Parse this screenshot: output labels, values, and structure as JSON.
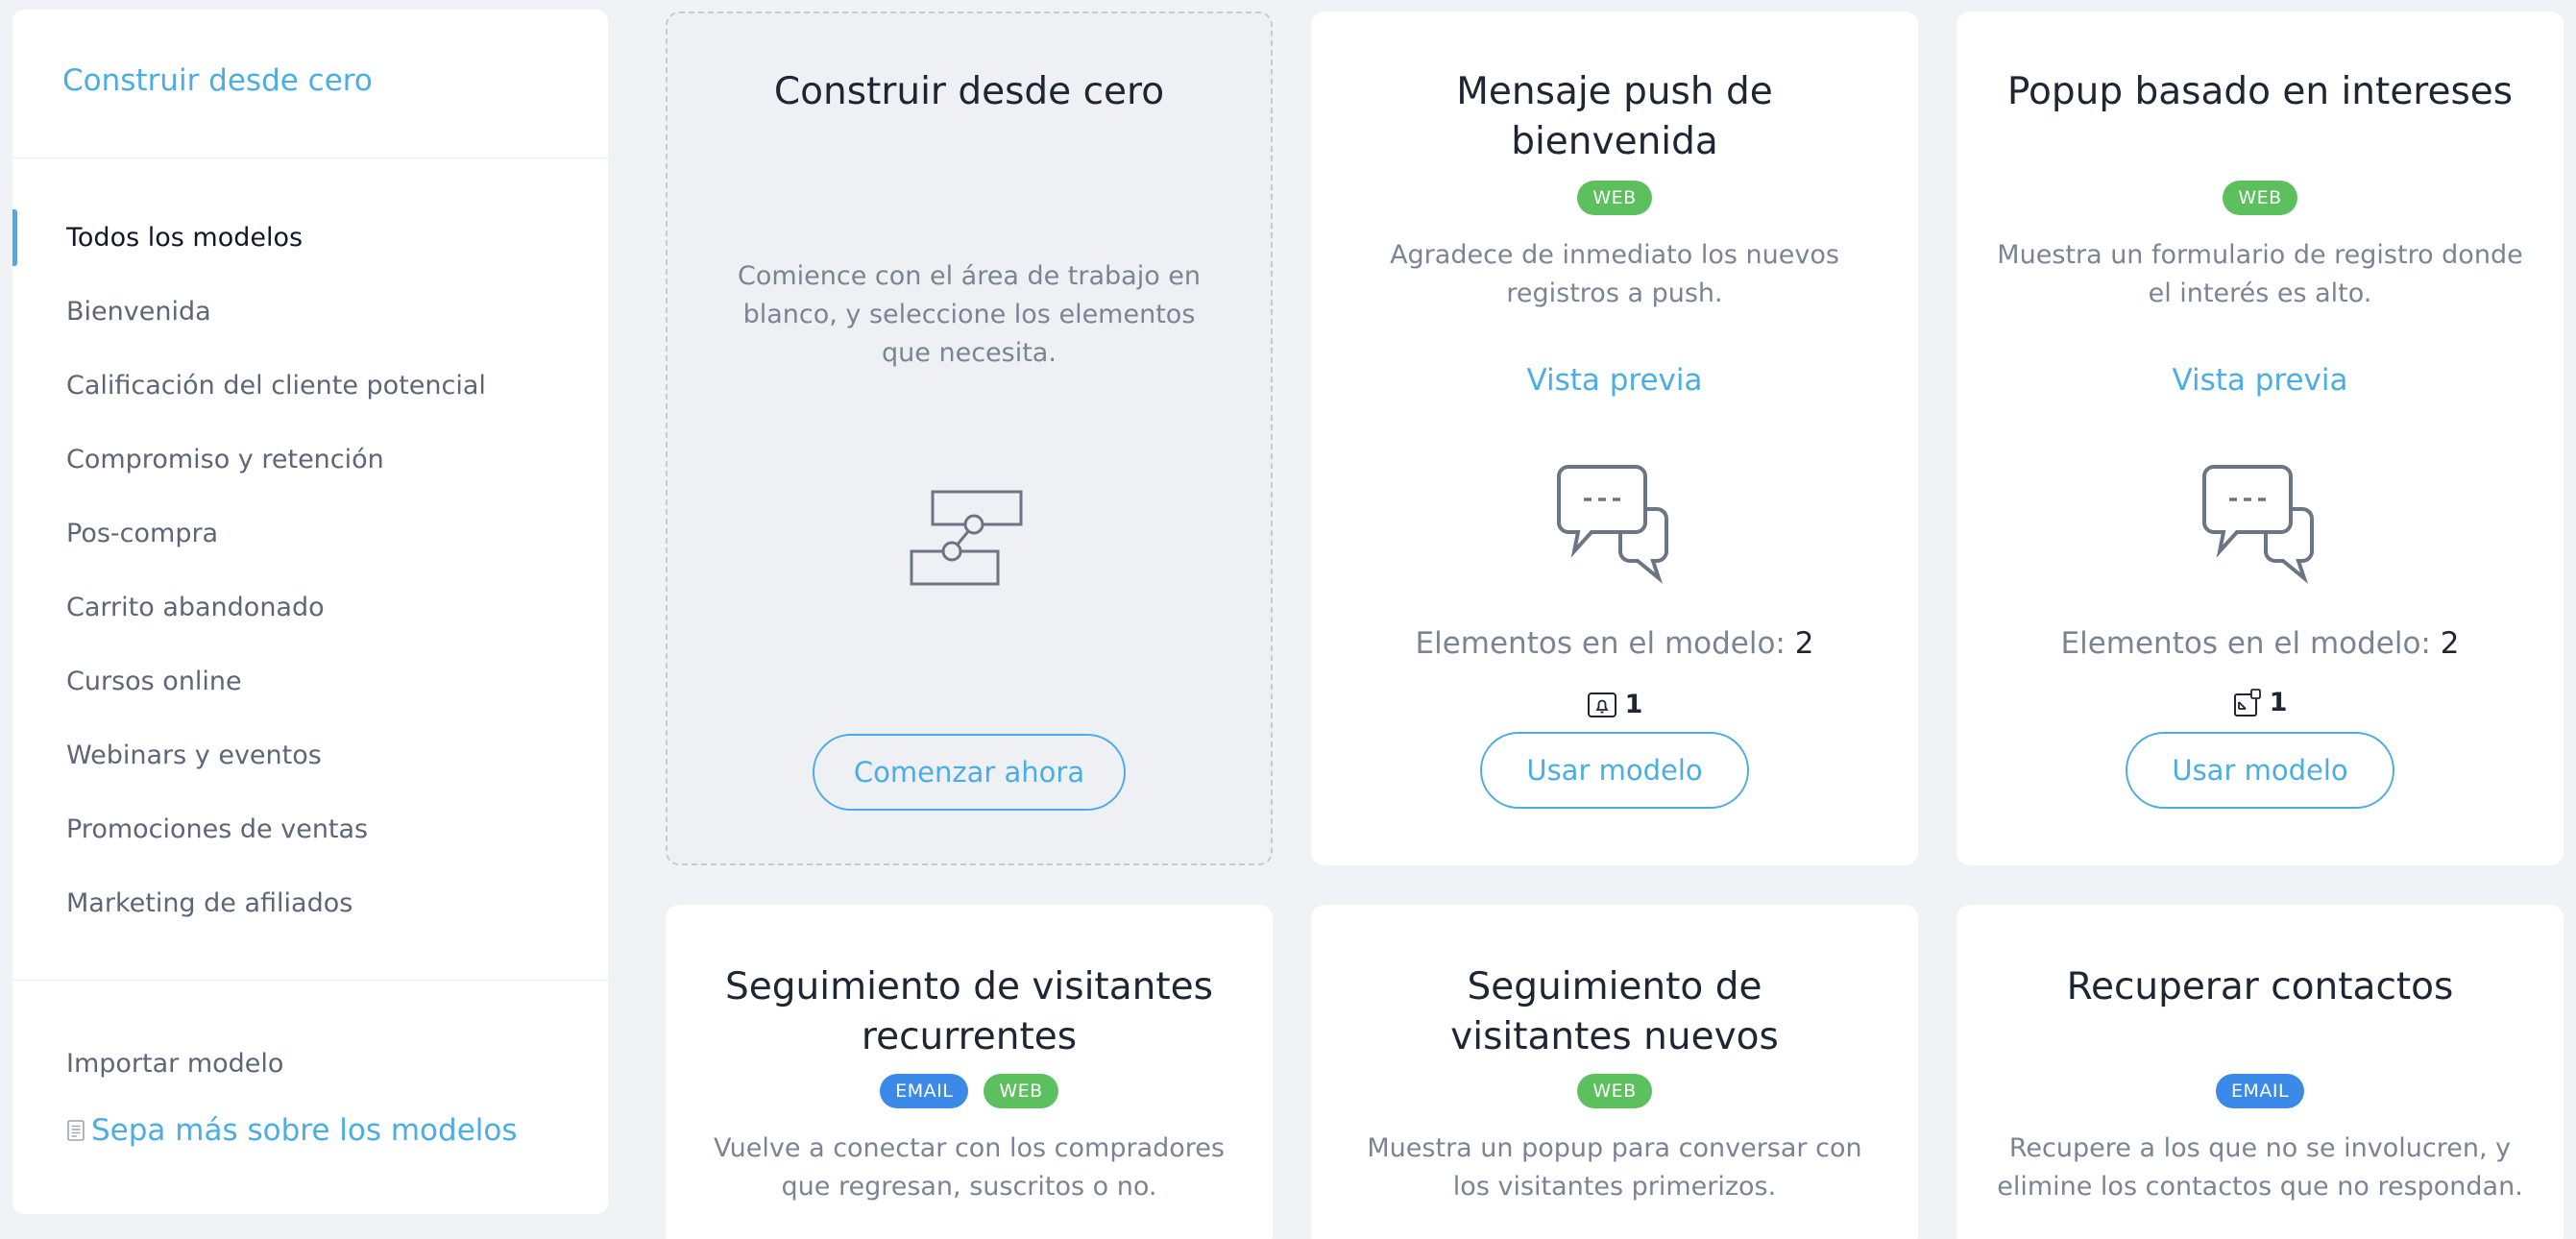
{
  "sidebar": {
    "top_link": "Construir desde cero",
    "items": [
      {
        "label": "Todos los modelos",
        "active": true
      },
      {
        "label": "Bienvenida"
      },
      {
        "label": "Calificación del cliente potencial"
      },
      {
        "label": "Compromiso y retención"
      },
      {
        "label": "Pos-compra"
      },
      {
        "label": "Carrito abandonado"
      },
      {
        "label": "Cursos online"
      },
      {
        "label": "Webinars y eventos"
      },
      {
        "label": "Promociones de ventas"
      },
      {
        "label": "Marketing de afiliados"
      }
    ],
    "import_label": "Importar modelo",
    "learn_label": "Sepa más sobre los modelos"
  },
  "blank_card": {
    "title": "Construir desde cero",
    "description": "Comience con el área de trabajo en blanco, y seleccione los elementos que necesita.",
    "button": "Comenzar ahora"
  },
  "cards": [
    {
      "title": "Mensaje push de bienvenida",
      "badges": [
        "WEB"
      ],
      "description": "Agradece de inmediato los nuevos registros a push.",
      "preview": "Vista previa",
      "elements_label": "Elementos en el modelo:",
      "elements_count": "2",
      "item_count": "1",
      "button": "Usar modelo"
    },
    {
      "title": "Popup basado en intereses",
      "badges": [
        "WEB"
      ],
      "description": "Muestra un formulario de registro donde el interés es alto.",
      "preview": "Vista previa",
      "elements_label": "Elementos en el modelo:",
      "elements_count": "2",
      "item_count": "1",
      "button": "Usar modelo"
    },
    {
      "title": "Seguimiento de visitantes recurrentes",
      "badges": [
        "EMAIL",
        "WEB"
      ],
      "description": "Vuelve a conectar con los compradores que regresan, suscritos o no."
    },
    {
      "title": "Seguimiento de visitantes nuevos",
      "badges": [
        "WEB"
      ],
      "description": "Muestra un popup para conversar con los visitantes primerizos."
    },
    {
      "title": "Recuperar contactos",
      "badges": [
        "EMAIL"
      ],
      "description": "Recupere a los que no se involucren, y elimine los contactos que no respondan."
    }
  ]
}
